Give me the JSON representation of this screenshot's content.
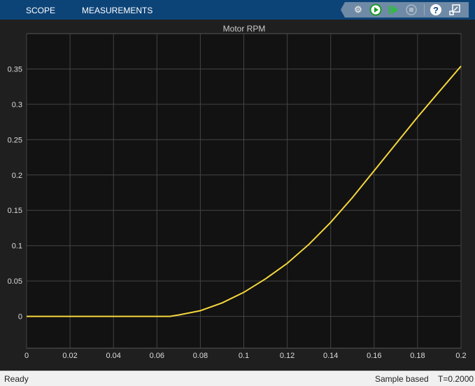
{
  "toolbar": {
    "tabs": [
      "SCOPE",
      "MEASUREMENTS"
    ],
    "icons": [
      "settings-icon",
      "run-icon",
      "step-forward-icon",
      "stop-icon",
      "help-icon",
      "undock-icon"
    ],
    "help_glyph": "?"
  },
  "status": {
    "left": "Ready",
    "mode": "Sample based",
    "time": "T=0.2000"
  },
  "colors": {
    "toolbar": "#0d4478",
    "plot_bg": "#121212",
    "grid": "#444444",
    "line": "#f5d63d"
  },
  "chart_data": {
    "type": "line",
    "title": "Motor RPM",
    "xlabel": "",
    "ylabel": "",
    "xlim": [
      0,
      0.2
    ],
    "ylim": [
      -0.045,
      0.4
    ],
    "xticks": [
      0,
      0.02,
      0.04,
      0.06,
      0.08,
      0.1,
      0.12,
      0.14,
      0.16,
      0.18,
      0.2
    ],
    "xtick_labels": [
      "0",
      "0.02",
      "0.04",
      "0.06",
      "0.08",
      "0.1",
      "0.12",
      "0.14",
      "0.16",
      "0.18",
      "0.2"
    ],
    "yticks": [
      0,
      0.05,
      0.1,
      0.15,
      0.2,
      0.25,
      0.3,
      0.35
    ],
    "ytick_labels": [
      "0",
      "0.05",
      "0.1",
      "0.15",
      "0.2",
      "0.25",
      "0.3",
      "0.35"
    ],
    "grid": true,
    "series": [
      {
        "x": [
          0,
          0.066,
          0.07,
          0.08,
          0.09,
          0.1,
          0.11,
          0.12,
          0.13,
          0.14,
          0.15,
          0.16,
          0.17,
          0.18,
          0.19,
          0.2
        ],
        "y": [
          0,
          0,
          0.002,
          0.008,
          0.019,
          0.034,
          0.053,
          0.075,
          0.102,
          0.133,
          0.168,
          0.206,
          0.244,
          0.282,
          0.318,
          0.354
        ]
      }
    ]
  }
}
